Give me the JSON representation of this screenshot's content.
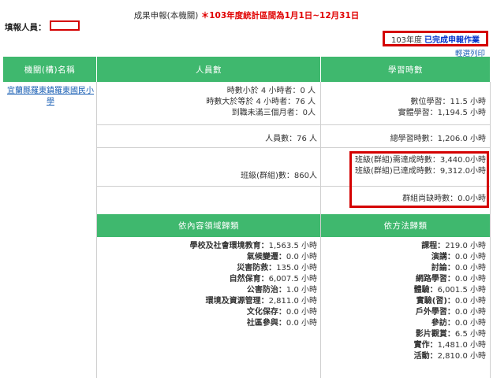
{
  "header": {
    "title": "成果申報(本機關)",
    "period": "＊103年度統計區間為1月1日~12月31日"
  },
  "filler": {
    "label": "填報人員："
  },
  "status": {
    "year": "103年度",
    "state": "已完成申報作業",
    "print_link": "輕選列印"
  },
  "table": {
    "columns": {
      "org": "機關(構)名稱",
      "staff": "人員數",
      "hours": "學習時數"
    },
    "org_name": "宜蘭縣羅東鎮羅東國民小學",
    "staff": {
      "lt4_label": "時數小於 4 小時者：",
      "lt4_value": "0 人",
      "ge4_label": "時數大於等於 4 小時者：",
      "ge4_value": "76 人",
      "new_label": "到職未滿三個月者：",
      "new_value": "0人",
      "total_label": "人員數：",
      "total_value": "76 人",
      "class_label": "班級(群組)數：",
      "class_value": "860人"
    },
    "hours": {
      "digital_label": "數位學習：",
      "digital_value": "11.5 小時",
      "physical_label": "實體學習：",
      "physical_value": "1,194.5 小時",
      "total_label": "總學習時數：",
      "total_value": "1,206.0 小時",
      "class_required_label": "班級(群組)需達成時數：",
      "class_required_value": "3,440.0小時",
      "class_achieved_label": "班級(群組)已達成時數：",
      "class_achieved_value": "9,312.0小時",
      "group_short_label": "群組尚缺時數：",
      "group_short_value": "0.0小時"
    }
  },
  "breakdown": {
    "domain_header": "依內容領域歸類",
    "method_header": "依方法歸類",
    "domains": [
      {
        "label": "學校及社會環境教育：",
        "value": "1,563.5 小時"
      },
      {
        "label": "氣候變遷：",
        "value": "0.0 小時"
      },
      {
        "label": "災害防救：",
        "value": "135.0 小時"
      },
      {
        "label": "自然保育：",
        "value": "6,007.5 小時"
      },
      {
        "label": "公害防治：",
        "value": "1.0 小時"
      },
      {
        "label": "環境及資源管理：",
        "value": "2,811.0 小時"
      },
      {
        "label": "文化保存：",
        "value": "0.0 小時"
      },
      {
        "label": "社區參與：",
        "value": "0.0 小時"
      }
    ],
    "methods": [
      {
        "label": "課程：",
        "value": "219.0 小時"
      },
      {
        "label": "演講：",
        "value": "0.0 小時"
      },
      {
        "label": "討論：",
        "value": "0.0 小時"
      },
      {
        "label": "網路學習：",
        "value": "0.0 小時"
      },
      {
        "label": "體驗：",
        "value": "6,001.5 小時"
      },
      {
        "label": "實驗(習)：",
        "value": "0.0 小時"
      },
      {
        "label": "戶外學習：",
        "value": "0.0 小時"
      },
      {
        "label": "參訪：",
        "value": "0.0 小時"
      },
      {
        "label": "影片觀賞：",
        "value": "6.5 小時"
      },
      {
        "label": "實作：",
        "value": "1,481.0 小時"
      },
      {
        "label": "活動：",
        "value": "2,810.0 小時"
      }
    ]
  }
}
